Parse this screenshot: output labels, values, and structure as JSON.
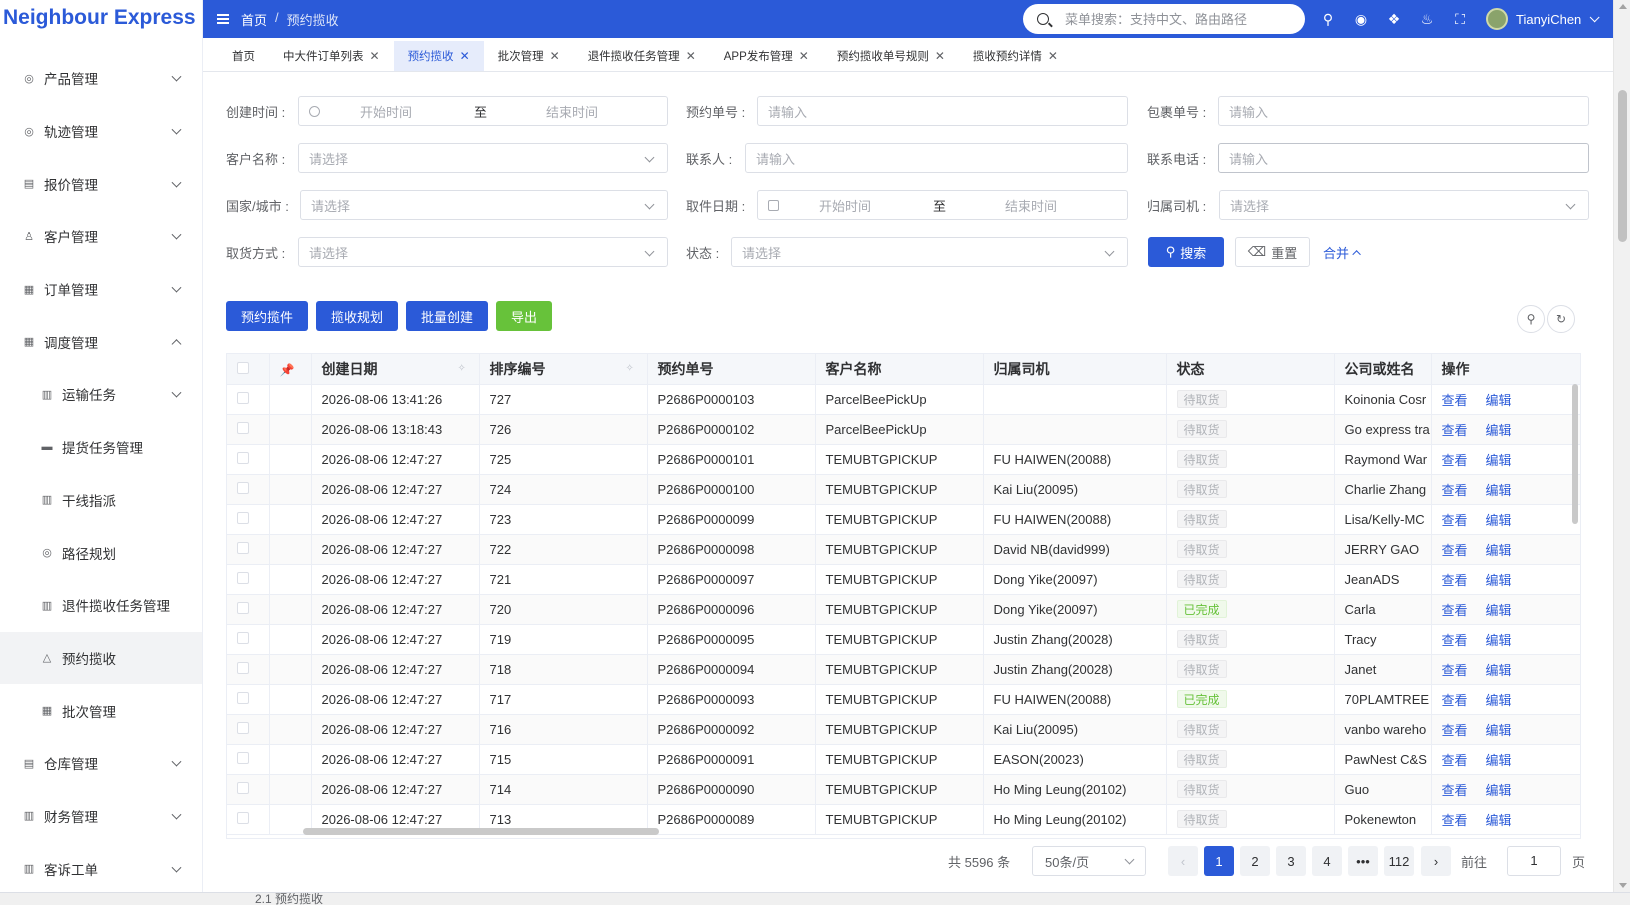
{
  "app": {
    "logo": "Neighbour Express"
  },
  "sidebar": {
    "items": [
      {
        "label": "产品管理",
        "icon": "circle-icon",
        "expanded": false,
        "sub": false
      },
      {
        "label": "轨迹管理",
        "icon": "circle-icon",
        "expanded": false,
        "sub": false
      },
      {
        "label": "报价管理",
        "icon": "table-icon",
        "expanded": false,
        "sub": false
      },
      {
        "label": "客户管理",
        "icon": "user-icon",
        "expanded": false,
        "sub": false
      },
      {
        "label": "订单管理",
        "icon": "grid-icon",
        "expanded": false,
        "sub": false
      },
      {
        "label": "调度管理",
        "icon": "grid-icon",
        "expanded": true,
        "sub": false
      },
      {
        "label": "运输任务",
        "icon": "doc-icon",
        "expanded": false,
        "sub": true
      },
      {
        "label": "提货任务管理",
        "icon": "truck-icon",
        "sub": true
      },
      {
        "label": "干线指派",
        "icon": "doc-icon",
        "sub": true
      },
      {
        "label": "路径规划",
        "icon": "circle-icon",
        "sub": true
      },
      {
        "label": "退件揽收任务管理",
        "icon": "doc-icon",
        "sub": true
      },
      {
        "label": "预约揽收",
        "icon": "triangle-icon",
        "sub": true,
        "active": true
      },
      {
        "label": "批次管理",
        "icon": "grid-icon",
        "sub": true
      },
      {
        "label": "仓库管理",
        "icon": "table-icon",
        "expanded": false,
        "sub": false
      },
      {
        "label": "财务管理",
        "icon": "doc-icon",
        "expanded": false,
        "sub": false
      },
      {
        "label": "客诉工单",
        "icon": "doc-icon",
        "expanded": false,
        "sub": false
      }
    ]
  },
  "header": {
    "breadcrumb_home": "首页",
    "breadcrumb_sep": "/",
    "breadcrumb_current": "预约揽收",
    "search_placeholder": "菜单搜索：支持中文、路由路径",
    "user_name": "TianyiChen"
  },
  "tabs": [
    {
      "label": "首页",
      "closable": false,
      "active": false
    },
    {
      "label": "中大件订单列表",
      "closable": true,
      "active": false
    },
    {
      "label": "预约揽收",
      "closable": true,
      "active": true
    },
    {
      "label": "批次管理",
      "closable": true,
      "active": false
    },
    {
      "label": "退件揽收任务管理",
      "closable": true,
      "active": false
    },
    {
      "label": "APP发布管理",
      "closable": true,
      "active": false
    },
    {
      "label": "预约揽收单号规则",
      "closable": true,
      "active": false
    },
    {
      "label": "揽收预约详情",
      "closable": true,
      "active": false
    }
  ],
  "filters": {
    "create_time_label": "创建时间 :",
    "start_placeholder": "开始时间",
    "range_sep": "至",
    "end_placeholder": "结束时间",
    "order_no_label": "预约单号 :",
    "package_no_label": "包裹单号 :",
    "input_placeholder": "请输入",
    "select_placeholder": "请选择",
    "customer_label": "客户名称 :",
    "contact_label": "联系人 :",
    "phone_label": "联系电话 :",
    "country_label": "国家/城市 :",
    "pickup_date_label": "取件日期 :",
    "driver_label": "归属司机 :",
    "pickup_method_label": "取货方式 :",
    "status_label": "状态 :",
    "search_btn": "搜索",
    "reset_btn": "重置",
    "collapse_link": "合并"
  },
  "actions": {
    "book_pickup": "预约揽件",
    "pickup_plan": "揽收规划",
    "batch_create": "批量创建",
    "export": "导出"
  },
  "table": {
    "columns": [
      "创建日期",
      "排序编号",
      "预约单号",
      "客户名称",
      "归属司机",
      "状态",
      "公司或姓名",
      "操作"
    ],
    "view_label": "查看",
    "edit_label": "编辑",
    "rows": [
      {
        "date": "2026-08-06 13:41:26",
        "seq": "727",
        "no": "P2686P0000103",
        "customer": "ParcelBeePickUp",
        "driver": "",
        "status": "待取货",
        "status_color": "#b0b3b8",
        "company": "Koinonia Cosr"
      },
      {
        "date": "2026-08-06 13:18:43",
        "seq": "726",
        "no": "P2686P0000102",
        "customer": "ParcelBeePickUp",
        "driver": "",
        "status": "待取货",
        "status_color": "#b0b3b8",
        "company": "Go express tra"
      },
      {
        "date": "2026-08-06 12:47:27",
        "seq": "725",
        "no": "P2686P0000101",
        "customer": "TEMUBTGPICKUP",
        "driver": "FU HAIWEN(20088)",
        "status": "待取货",
        "status_color": "#b0b3b8",
        "company": "Raymond War"
      },
      {
        "date": "2026-08-06 12:47:27",
        "seq": "724",
        "no": "P2686P0000100",
        "customer": "TEMUBTGPICKUP",
        "driver": "Kai Liu(20095)",
        "status": "待取货",
        "status_color": "#b0b3b8",
        "company": "Charlie Zhang"
      },
      {
        "date": "2026-08-06 12:47:27",
        "seq": "723",
        "no": "P2686P0000099",
        "customer": "TEMUBTGPICKUP",
        "driver": "FU HAIWEN(20088)",
        "status": "待取货",
        "status_color": "#b0b3b8",
        "company": "Lisa/Kelly-MC"
      },
      {
        "date": "2026-08-06 12:47:27",
        "seq": "722",
        "no": "P2686P0000098",
        "customer": "TEMUBTGPICKUP",
        "driver": "David NB(david999)",
        "status": "待取货",
        "status_color": "#b0b3b8",
        "company": "JERRY GAO"
      },
      {
        "date": "2026-08-06 12:47:27",
        "seq": "721",
        "no": "P2686P0000097",
        "customer": "TEMUBTGPICKUP",
        "driver": "Dong Yike(20097)",
        "status": "待取货",
        "status_color": "#b0b3b8",
        "company": "JeanADS"
      },
      {
        "date": "2026-08-06 12:47:27",
        "seq": "720",
        "no": "P2686P0000096",
        "customer": "TEMUBTGPICKUP",
        "driver": "Dong Yike(20097)",
        "status": "已完成",
        "status_color": "#67c23a",
        "company": "Carla"
      },
      {
        "date": "2026-08-06 12:47:27",
        "seq": "719",
        "no": "P2686P0000095",
        "customer": "TEMUBTGPICKUP",
        "driver": "Justin Zhang(20028)",
        "status": "待取货",
        "status_color": "#b0b3b8",
        "company": "Tracy"
      },
      {
        "date": "2026-08-06 12:47:27",
        "seq": "718",
        "no": "P2686P0000094",
        "customer": "TEMUBTGPICKUP",
        "driver": "Justin Zhang(20028)",
        "status": "待取货",
        "status_color": "#b0b3b8",
        "company": "Janet"
      },
      {
        "date": "2026-08-06 12:47:27",
        "seq": "717",
        "no": "P2686P0000093",
        "customer": "TEMUBTGPICKUP",
        "driver": "FU HAIWEN(20088)",
        "status": "已完成",
        "status_color": "#67c23a",
        "company": "70PLAMTREE"
      },
      {
        "date": "2026-08-06 12:47:27",
        "seq": "716",
        "no": "P2686P0000092",
        "customer": "TEMUBTGPICKUP",
        "driver": "Kai Liu(20095)",
        "status": "待取货",
        "status_color": "#b0b3b8",
        "company": "vanbo wareho"
      },
      {
        "date": "2026-08-06 12:47:27",
        "seq": "715",
        "no": "P2686P0000091",
        "customer": "TEMUBTGPICKUP",
        "driver": "EASON(20023)",
        "status": "待取货",
        "status_color": "#b0b3b8",
        "company": "PawNest C&S"
      },
      {
        "date": "2026-08-06 12:47:27",
        "seq": "714",
        "no": "P2686P0000090",
        "customer": "TEMUBTGPICKUP",
        "driver": "Ho Ming Leung(20102)",
        "status": "待取货",
        "status_color": "#b0b3b8",
        "company": "Guo"
      },
      {
        "date": "2026-08-06 12:47:27",
        "seq": "713",
        "no": "P2686P0000089",
        "customer": "TEMUBTGPICKUP",
        "driver": "Ho Ming Leung(20102)",
        "status": "待取货",
        "status_color": "#b0b3b8",
        "company": "Pokenewton"
      }
    ]
  },
  "pagination": {
    "total_text": "共 5596 条",
    "page_size": "50条/页",
    "pages": [
      "1",
      "2",
      "3",
      "4",
      "•••",
      "112"
    ],
    "current_page": "1",
    "goto_label": "前往",
    "goto_value": "1",
    "page_suffix": "页"
  },
  "bottom": {
    "text": "2.1 预约揽收"
  },
  "colors": {
    "primary": "#2b5ad8",
    "success": "#67c23a"
  }
}
